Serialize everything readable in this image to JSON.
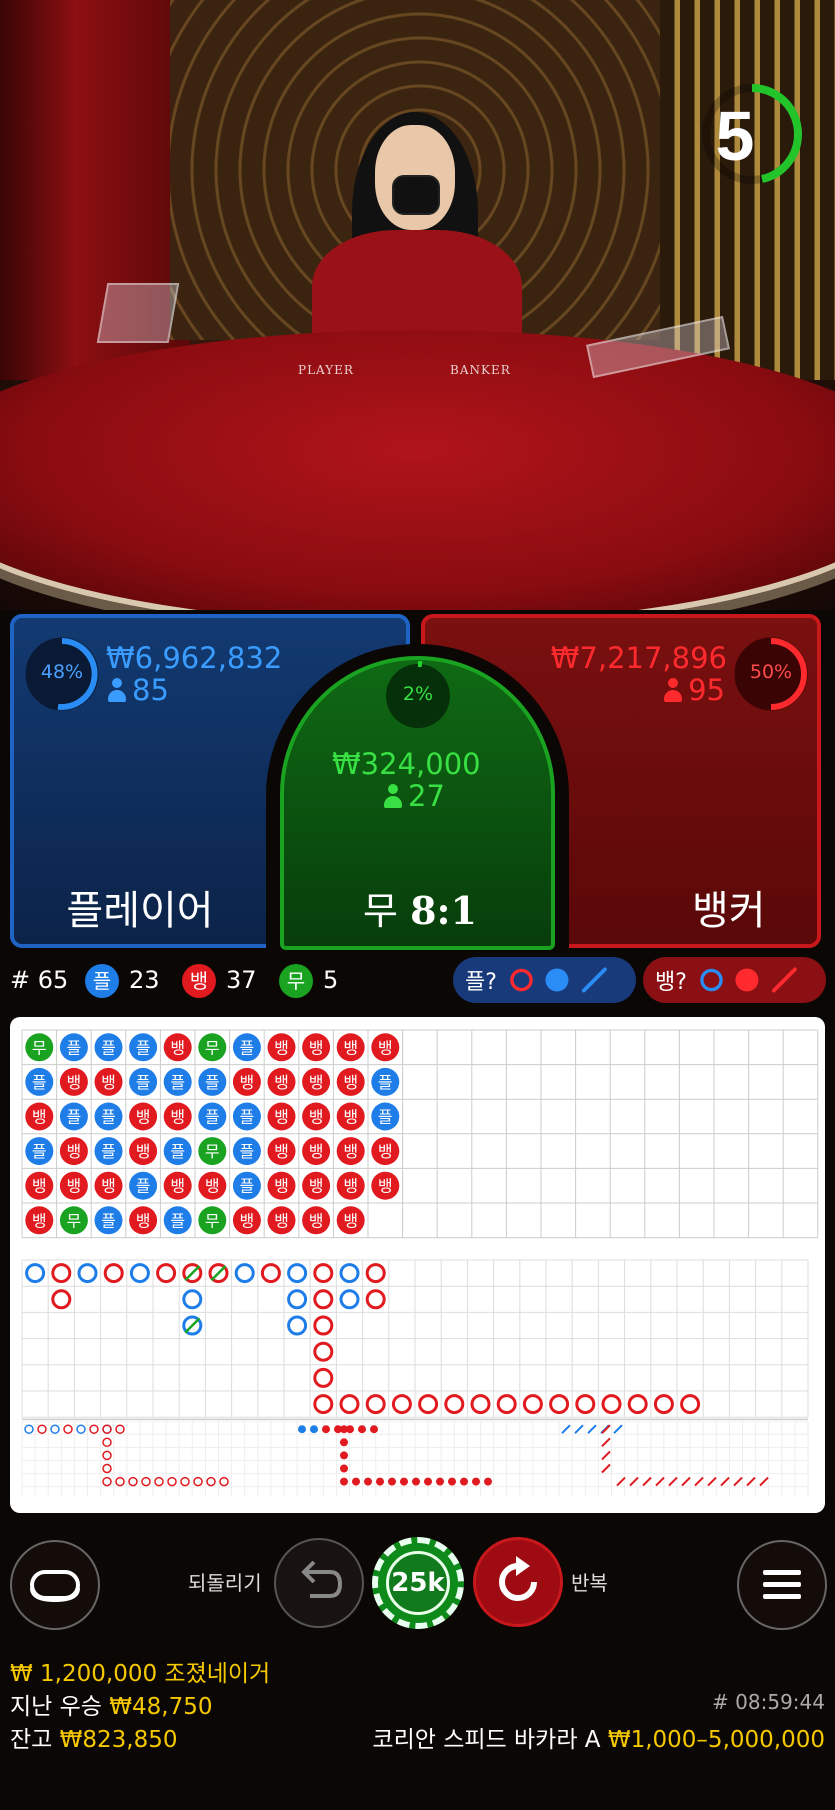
{
  "video": {
    "timer": "5",
    "table_left": "PLAYER",
    "table_right": "BANKER"
  },
  "player": {
    "pct": "48%",
    "amount": "₩6,962,832",
    "bettors": "85",
    "label": "플레이어"
  },
  "tie": {
    "pct": "2%",
    "amount": "₩324,000",
    "bettors": "27",
    "label_char": "무",
    "label_odds": "8:1"
  },
  "banker": {
    "pct": "50%",
    "amount": "₩7,217,896",
    "bettors": "95",
    "label": "뱅커"
  },
  "stats": {
    "round": "# 65",
    "player_char": "플",
    "player_count": "23",
    "banker_char": "뱅",
    "banker_count": "37",
    "tie_char": "무",
    "tie_count": "5"
  },
  "ask": {
    "player_label": "플?",
    "banker_label": "뱅?"
  },
  "bead_road": [
    [
      "무",
      "플",
      "뱅",
      "플",
      "뱅",
      "뱅"
    ],
    [
      "플",
      "뱅",
      "플",
      "뱅",
      "뱅",
      "무"
    ],
    [
      "플",
      "뱅",
      "플",
      "플",
      "뱅",
      "플"
    ],
    [
      "플",
      "플",
      "뱅",
      "뱅",
      "플",
      "뱅"
    ],
    [
      "뱅",
      "플",
      "뱅",
      "플",
      "뱅",
      "플"
    ],
    [
      "무",
      "플",
      "플",
      "무",
      "뱅",
      "무"
    ],
    [
      "플",
      "뱅",
      "플",
      "플",
      "플",
      "뱅"
    ],
    [
      "뱅",
      "뱅",
      "뱅",
      "뱅",
      "뱅",
      "뱅"
    ],
    [
      "뱅",
      "뱅",
      "뱅",
      "뱅",
      "뱅",
      "뱅"
    ],
    [
      "뱅",
      "뱅",
      "뱅",
      "뱅",
      "뱅",
      "뱅"
    ],
    [
      "뱅",
      "플",
      "플",
      "뱅",
      "뱅"
    ]
  ],
  "controls": {
    "undo_label": "되돌리기",
    "chip_value": "25k",
    "repeat_label": "반복"
  },
  "info": {
    "message": "₩ 1,200,000 조졌네이거",
    "last_win_label": "지난 우승",
    "last_win_value": "₩48,750",
    "balance_label": "잔고",
    "balance_value": "₩823,850",
    "time": "# 08:59:44",
    "table_name": "코리안 스피드 바카라 A",
    "limits": "₩1,000–5,000,000"
  },
  "colors": {
    "player": "#1f7de8",
    "banker": "#e01a1f",
    "tie": "#1aa321",
    "accent_gold": "#f5c800"
  }
}
